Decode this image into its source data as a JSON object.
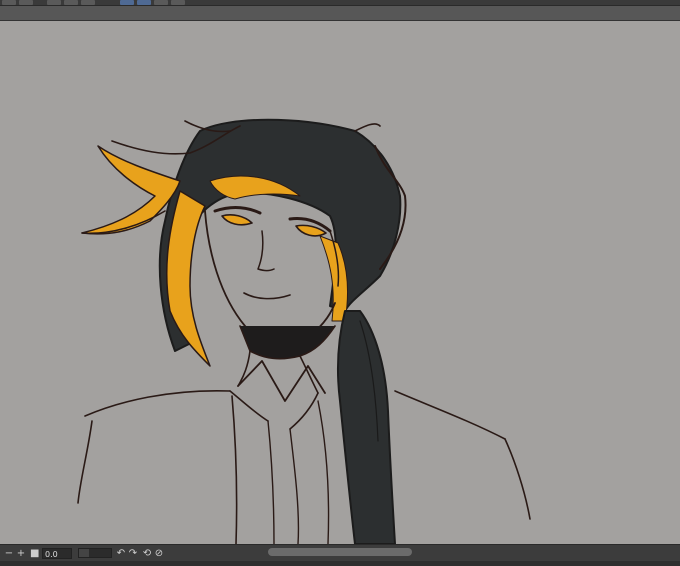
{
  "toolbar": {
    "icons": [
      "layer-icon",
      "selection-icon",
      "transform-icon",
      "brush-icon",
      "rotate-icon",
      "lasso-icon",
      "ruler-icon",
      "menu-icon",
      "balloon-icon"
    ]
  },
  "statusbar": {
    "zoom_out_glyph": "−",
    "zoom_in_glyph": "+",
    "zoom_value": "0.0",
    "rotate_left_glyph": "↶",
    "rotate_right_glyph": "↷",
    "reset_glyph": "⟲",
    "flip_glyph": "⊘",
    "zoom_slider_level": 0.3
  },
  "colors": {
    "canvas_bg": "#a3a19f",
    "line_art": "#2a1a16",
    "hair_dark": "#2c2f30",
    "hair_accent": "#e8a21c",
    "ui_dark": "#3c3c3c"
  }
}
